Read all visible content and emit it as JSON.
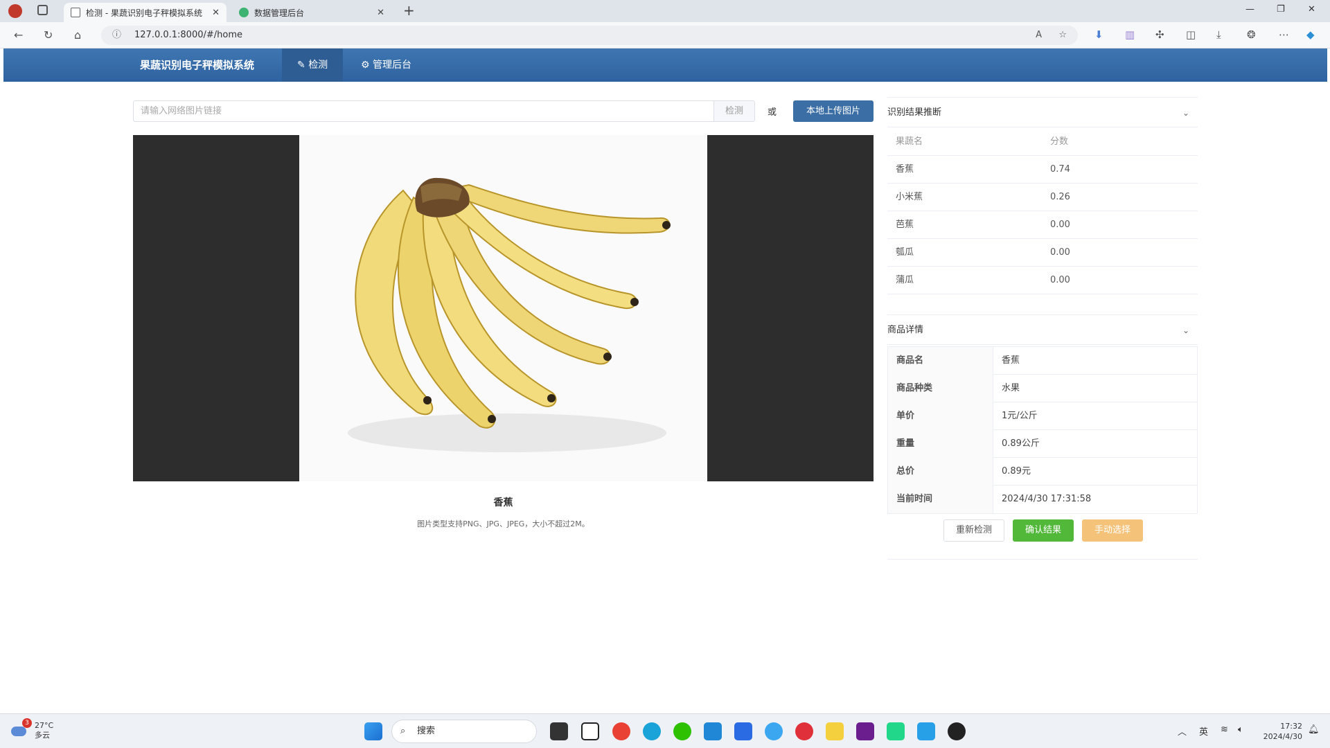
{
  "browser": {
    "tabs": [
      {
        "label": "检测 - 果蔬识别电子秤模拟系统",
        "active": true
      },
      {
        "label": "数据管理后台",
        "active": false
      }
    ],
    "url": "127.0.0.1:8000/#/home"
  },
  "app": {
    "brand": "果蔬识别电子秤模拟系统",
    "nav": [
      {
        "label": "检测",
        "icon": "leaf-icon",
        "active": true
      },
      {
        "label": "管理后台",
        "icon": "settings-icon",
        "active": false
      }
    ]
  },
  "detect": {
    "url_placeholder": "请输入网络图片链接",
    "detect_label": "检测",
    "or_label": "或",
    "upload_label": "本地上传图片",
    "caption": "香蕉",
    "hint": "图片类型支持PNG、JPG、JPEG，大小不超过2M。"
  },
  "result": {
    "title": "识别结果推断",
    "col_name": "果蔬名",
    "col_score": "分数",
    "rows": [
      {
        "name": "香蕉",
        "score": "0.74"
      },
      {
        "name": "小米蕉",
        "score": "0.26"
      },
      {
        "name": "芭蕉",
        "score": "0.00"
      },
      {
        "name": "瓠瓜",
        "score": "0.00"
      },
      {
        "name": "蒲瓜",
        "score": "0.00"
      }
    ]
  },
  "details": {
    "title": "商品详情",
    "rows": [
      {
        "key": "商品名",
        "value": "香蕉"
      },
      {
        "key": "商品种类",
        "value": "水果"
      },
      {
        "key": "单价",
        "value": "1元/公斤"
      },
      {
        "key": "重量",
        "value": "0.89公斤"
      },
      {
        "key": "总价",
        "value": "0.89元"
      },
      {
        "key": "当前时间",
        "value": "2024/4/30 17:31:58"
      }
    ],
    "actions": {
      "redetect": "重新检测",
      "confirm": "确认结果",
      "manual": "手动选择"
    }
  },
  "taskbar": {
    "weather_temp": "27°C",
    "weather_desc": "多云",
    "weather_badge": "3",
    "search_label": "搜索",
    "ime": "英",
    "time": "17:32",
    "date": "2024/4/30"
  },
  "colors": {
    "appbar": "#3a6ea5",
    "confirm": "#52b83a",
    "manual": "#f5c27a"
  }
}
